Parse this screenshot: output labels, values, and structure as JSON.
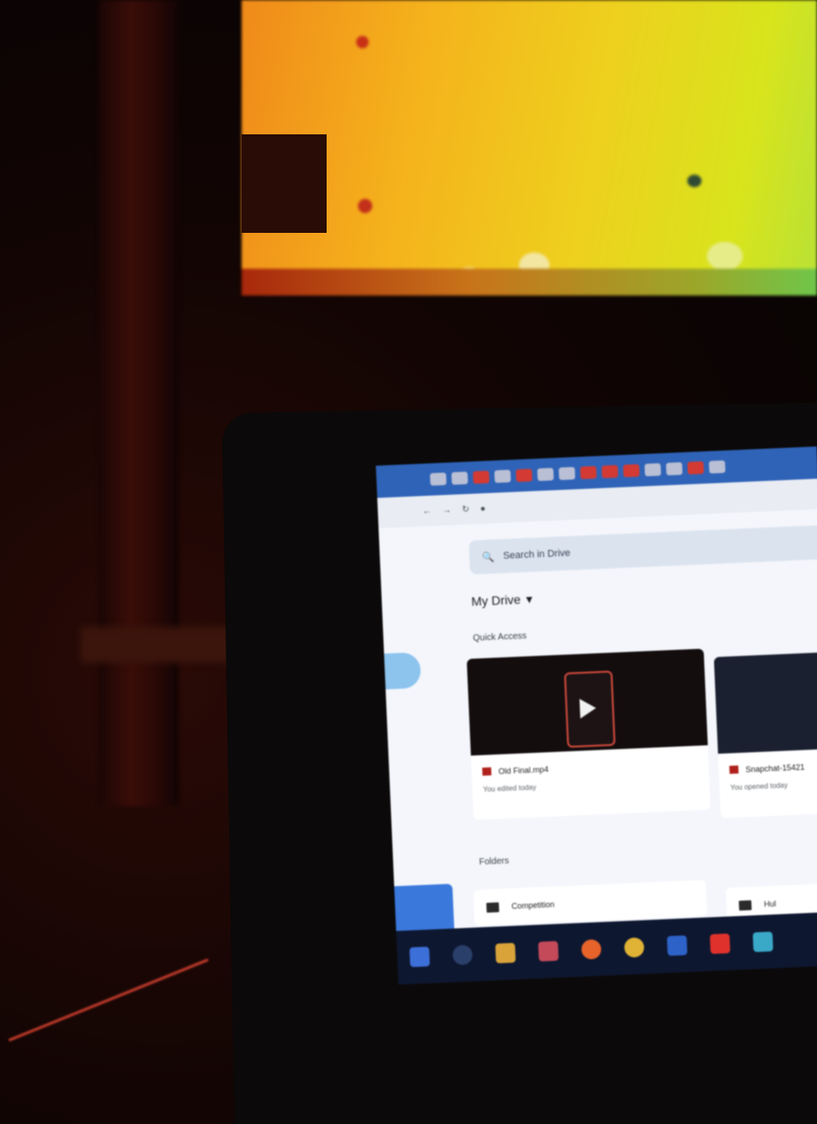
{
  "background_monitor": {
    "colors": {
      "left": "#f08a1a",
      "center": "#eed01e",
      "right": "#b8e236"
    }
  },
  "browser": {
    "tab_count": 14,
    "colors": {
      "tabbar": "#2f63b7",
      "accent_red": "#d23a33"
    }
  },
  "drive": {
    "search_placeholder": "Search in Drive",
    "title": "My Drive",
    "quick_access_label": "Quick Access",
    "folders_label": "Folders",
    "files": [
      {
        "name": "Old Final.mp4",
        "meta": "You edited today"
      },
      {
        "name": "Snapchat-15421",
        "meta": "You opened today"
      }
    ],
    "folder_items": [
      {
        "name": "Competition"
      },
      {
        "name": "Hul"
      }
    ]
  },
  "taskbar": {
    "icons": [
      "windows-icon",
      "search-icon",
      "files-icon",
      "media-icon",
      "firefox-icon",
      "chrome-icon",
      "store-icon",
      "youtube-icon",
      "photos-icon"
    ]
  }
}
